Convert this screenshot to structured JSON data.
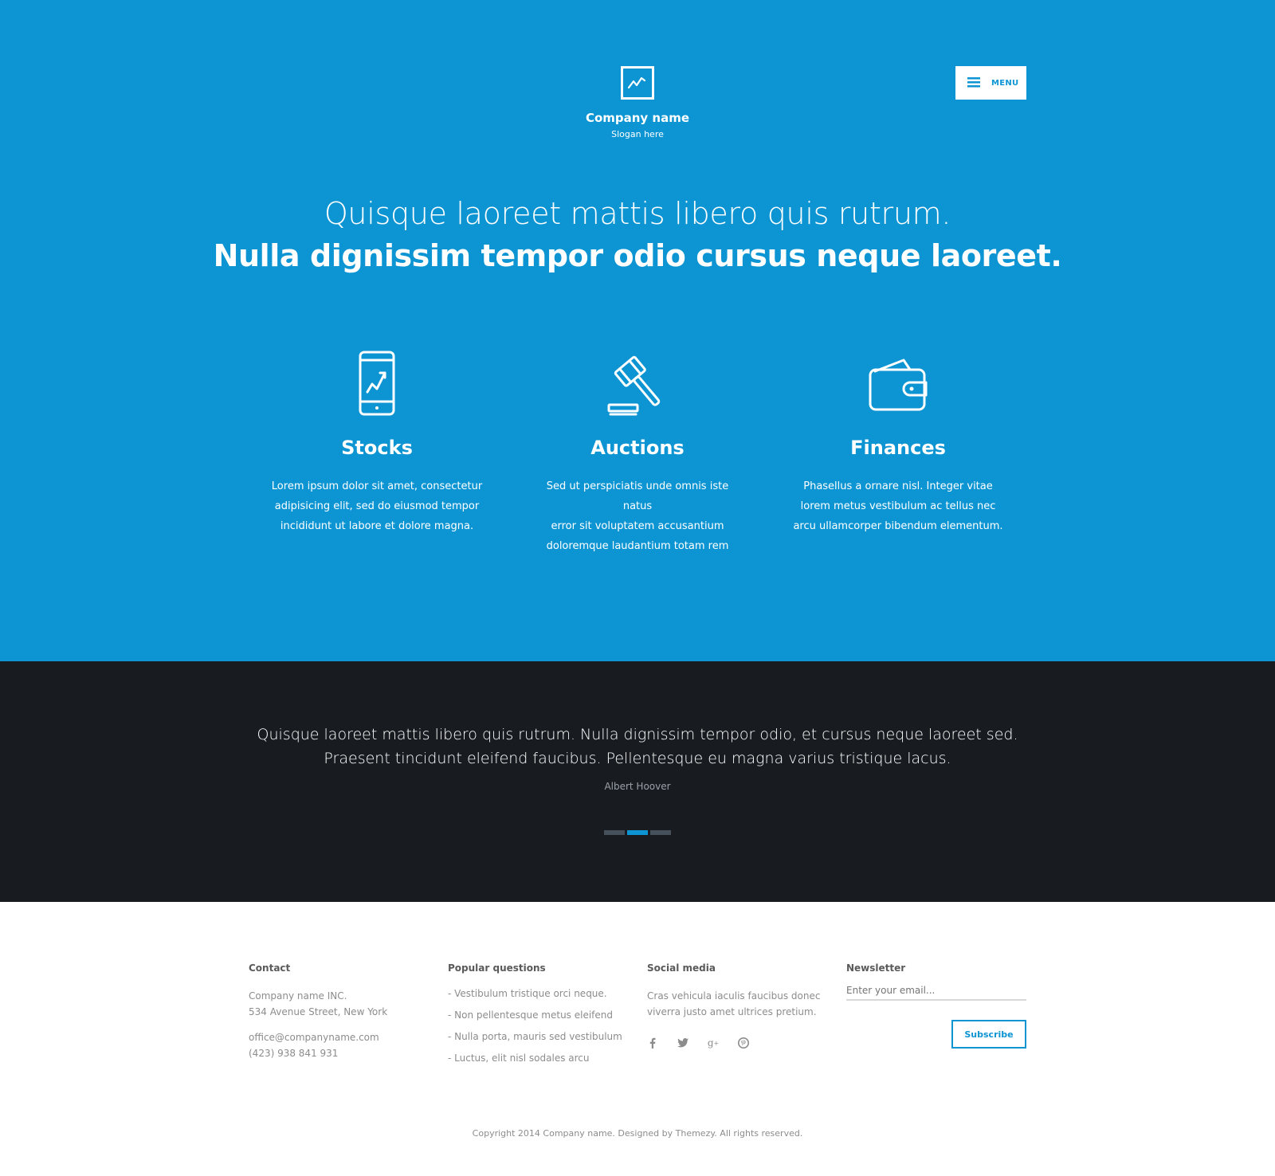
{
  "header": {
    "company_name": "Company name",
    "slogan": "Slogan here",
    "menu_label": "MENU",
    "logo_icon": "chart-line-icon",
    "menu_icon": "hamburger-icon"
  },
  "hero": {
    "headline_light": "Quisque laoreet mattis libero quis rutrum.",
    "headline_bold": "Nulla dignissim tempor odio cursus neque laoreet."
  },
  "features": [
    {
      "icon": "smartphone-chart-icon",
      "title": "Stocks",
      "lines": [
        "Lorem ipsum dolor sit amet, consectetur",
        "adipisicing elit, sed do eiusmod tempor",
        "incididunt ut labore et dolore magna."
      ]
    },
    {
      "icon": "gavel-icon",
      "title": "Auctions",
      "lines": [
        "Sed ut perspiciatis unde omnis iste natus",
        "error sit voluptatem accusantium",
        "doloremque laudantium totam rem"
      ]
    },
    {
      "icon": "wallet-icon",
      "title": "Finances",
      "lines": [
        "Phasellus a ornare nisl. Integer vitae",
        "lorem metus vestibulum ac tellus nec",
        "arcu ullamcorper bibendum elementum."
      ]
    }
  ],
  "testimonial": {
    "line1": "Quisque laoreet mattis libero quis rutrum. Nulla dignissim tempor odio, et cursus neque laoreet sed.",
    "line2": "Praesent tincidunt eleifend faucibus. Pellentesque eu magna varius tristique lacus.",
    "author": "Albert Hoover",
    "slides": 3,
    "active_slide": 2
  },
  "footer": {
    "contact": {
      "heading": "Contact",
      "company": "Company name INC.",
      "address": "534 Avenue Street, New York",
      "email": "office@companyname.com",
      "phone": "(423) 938 841 931"
    },
    "questions": {
      "heading": "Popular questions",
      "items": [
        "- Vestibulum tristique orci neque.",
        "- Non pellentesque metus eleifend",
        "- Nulla porta, mauris sed vestibulum",
        "- Luctus, elit nisl sodales arcu"
      ]
    },
    "social": {
      "heading": "Social media",
      "line1": "Cras vehicula iaculis faucibus donec",
      "line2": "viverra justo amet ultrices pretium.",
      "icons": [
        "facebook-icon",
        "twitter-icon",
        "google-plus-icon",
        "pinterest-icon"
      ]
    },
    "newsletter": {
      "heading": "Newsletter",
      "placeholder": "Enter your email...",
      "button": "Subscribe"
    },
    "copyright": "Copyright 2014 Company name. Designed by Themezy. All rights reserved."
  },
  "colors": {
    "primary": "#0d95d3",
    "dark": "#181c20",
    "text_muted": "#8c8c8c"
  }
}
